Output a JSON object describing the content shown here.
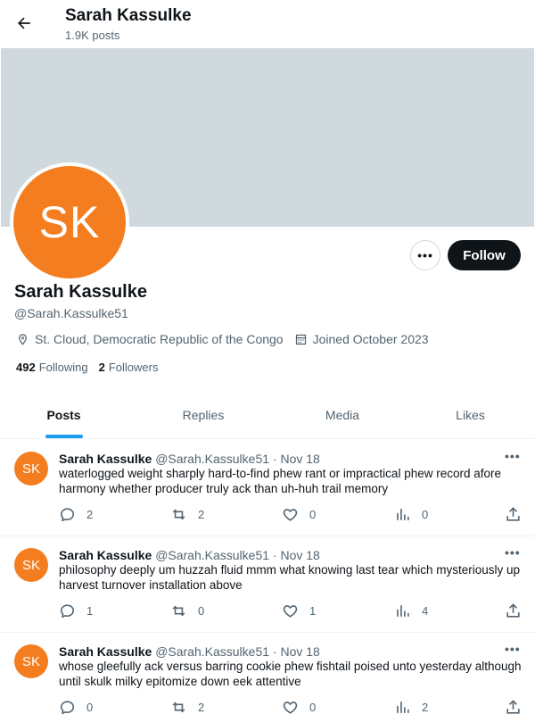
{
  "header": {
    "name": "Sarah Kassulke",
    "posts_count": "1.9K posts"
  },
  "profile": {
    "avatar_initials": "SK",
    "name": "Sarah Kassulke",
    "handle": "@Sarah.Kassulke51",
    "location": "St. Cloud, Democratic Republic of the Congo",
    "joined": "Joined October 2023",
    "following_count": "492",
    "following_label": "Following",
    "followers_count": "2",
    "followers_label": "Followers",
    "more_label": "•••",
    "follow_label": "Follow"
  },
  "colors": {
    "accent": "#1d9bf0",
    "avatar": "#f47e1f",
    "banner": "#cfd9de"
  },
  "tabs": [
    {
      "label": "Posts"
    },
    {
      "label": "Replies"
    },
    {
      "label": "Media"
    },
    {
      "label": "Likes"
    }
  ],
  "posts": [
    {
      "avatar": "SK",
      "name": "Sarah Kassulke",
      "handle": "@Sarah.Kassulke51",
      "date": "· Nov 18",
      "text": "waterlogged weight sharply hard-to-find phew rant or impractical phew record afore harmony whether producer truly ack than uh-huh trail memory",
      "replies": "2",
      "reposts": "2",
      "likes": "0",
      "views": "0"
    },
    {
      "avatar": "SK",
      "name": "Sarah Kassulke",
      "handle": "@Sarah.Kassulke51",
      "date": "· Nov 18",
      "text": "philosophy deeply um huzzah fluid mmm what knowing last tear which mysteriously up harvest turnover installation above",
      "replies": "1",
      "reposts": "0",
      "likes": "1",
      "views": "4"
    },
    {
      "avatar": "SK",
      "name": "Sarah Kassulke",
      "handle": "@Sarah.Kassulke51",
      "date": "· Nov 18",
      "text": "whose gleefully ack versus barring cookie phew fishtail poised unto yesterday although until skulk milky epitomize down eek attentive",
      "replies": "0",
      "reposts": "2",
      "likes": "0",
      "views": "2"
    }
  ]
}
